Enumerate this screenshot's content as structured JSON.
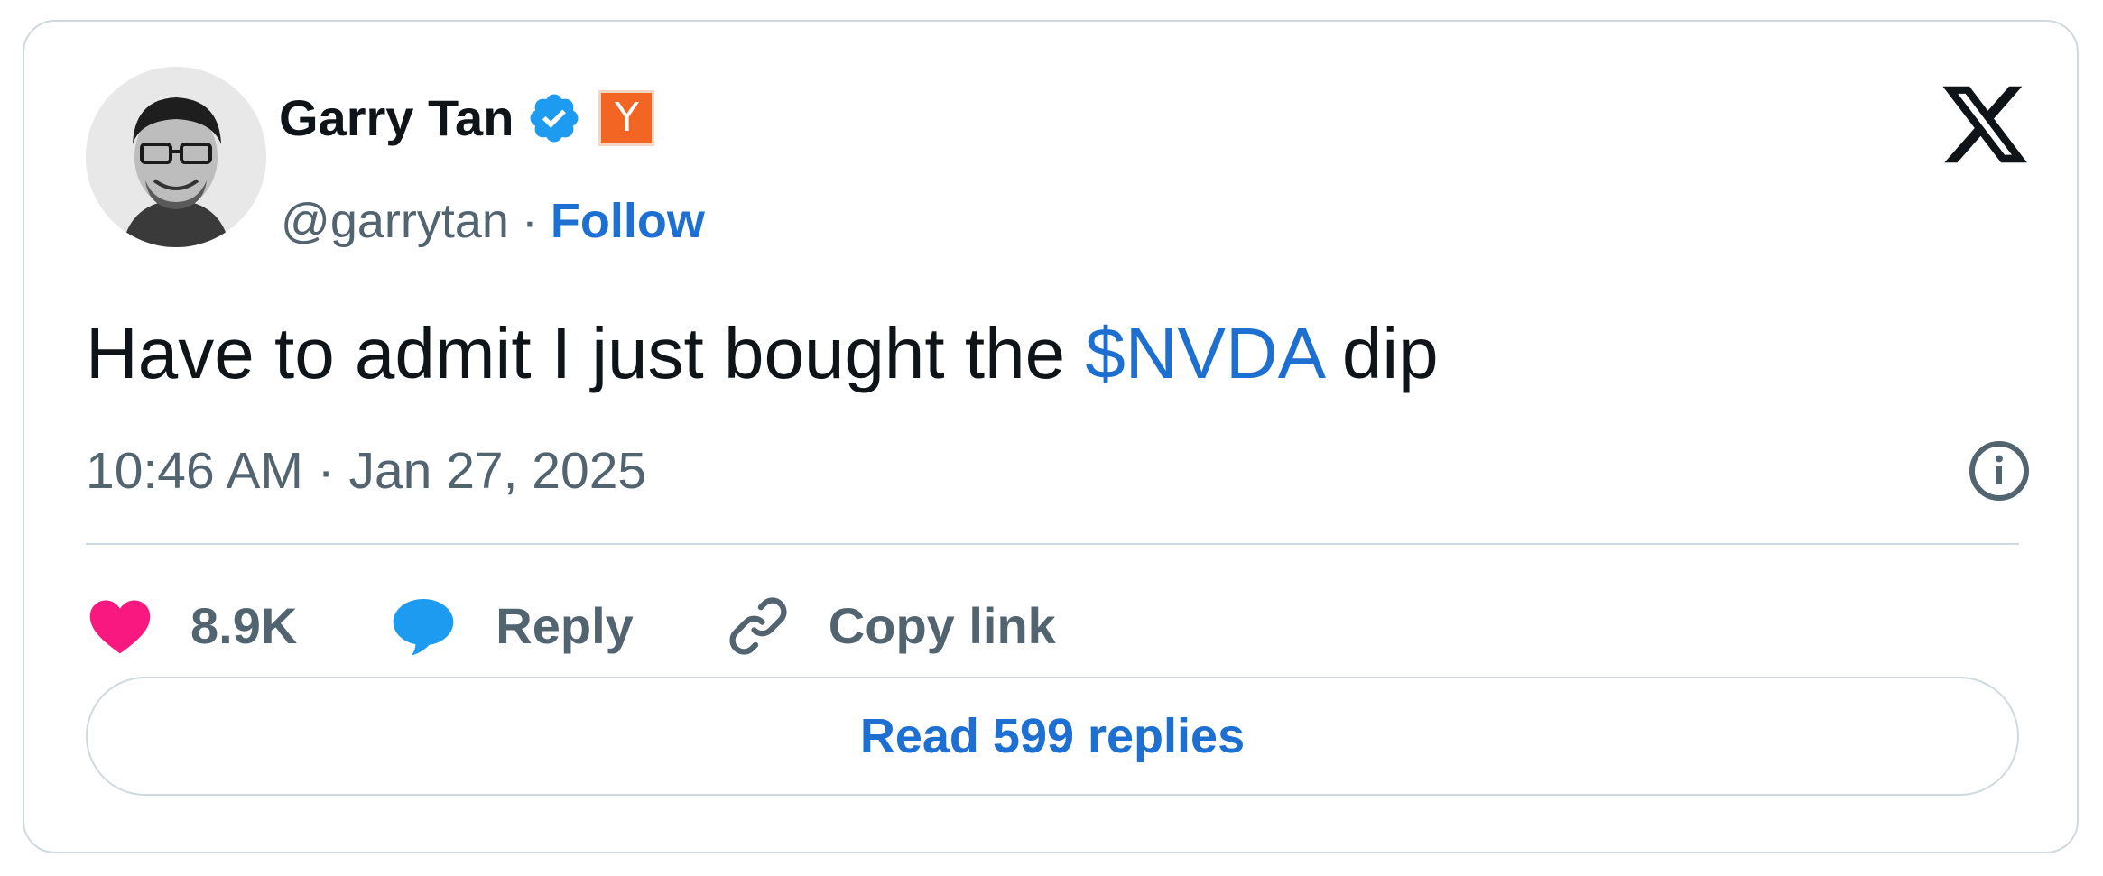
{
  "author": {
    "display_name": "Garry Tan",
    "handle": "@garrytan",
    "separator": "·",
    "follow_label": "Follow",
    "verified_icon": "verified-badge-icon",
    "affiliate_badge_letter": "Y",
    "affiliate_badge_color": "#f26522"
  },
  "tweet": {
    "text_before": "Have to admit I just bought the ",
    "cashtag": "$NVDA",
    "text_after": " dip",
    "timestamp": "10:46 AM · Jan 27, 2025"
  },
  "actions": {
    "likes_count": "8.9K",
    "reply_label": "Reply",
    "copy_link_label": "Copy link",
    "like_icon": "heart-icon",
    "reply_icon": "speech-bubble-icon",
    "copy_icon": "link-icon"
  },
  "read_replies_label": "Read 599 replies",
  "colors": {
    "link_blue": "#1d6fd1",
    "muted_text": "#536471",
    "text": "#0f1419",
    "heart": "#f91880",
    "reply_bubble": "#1d9bf0",
    "border": "#cfd9de"
  }
}
